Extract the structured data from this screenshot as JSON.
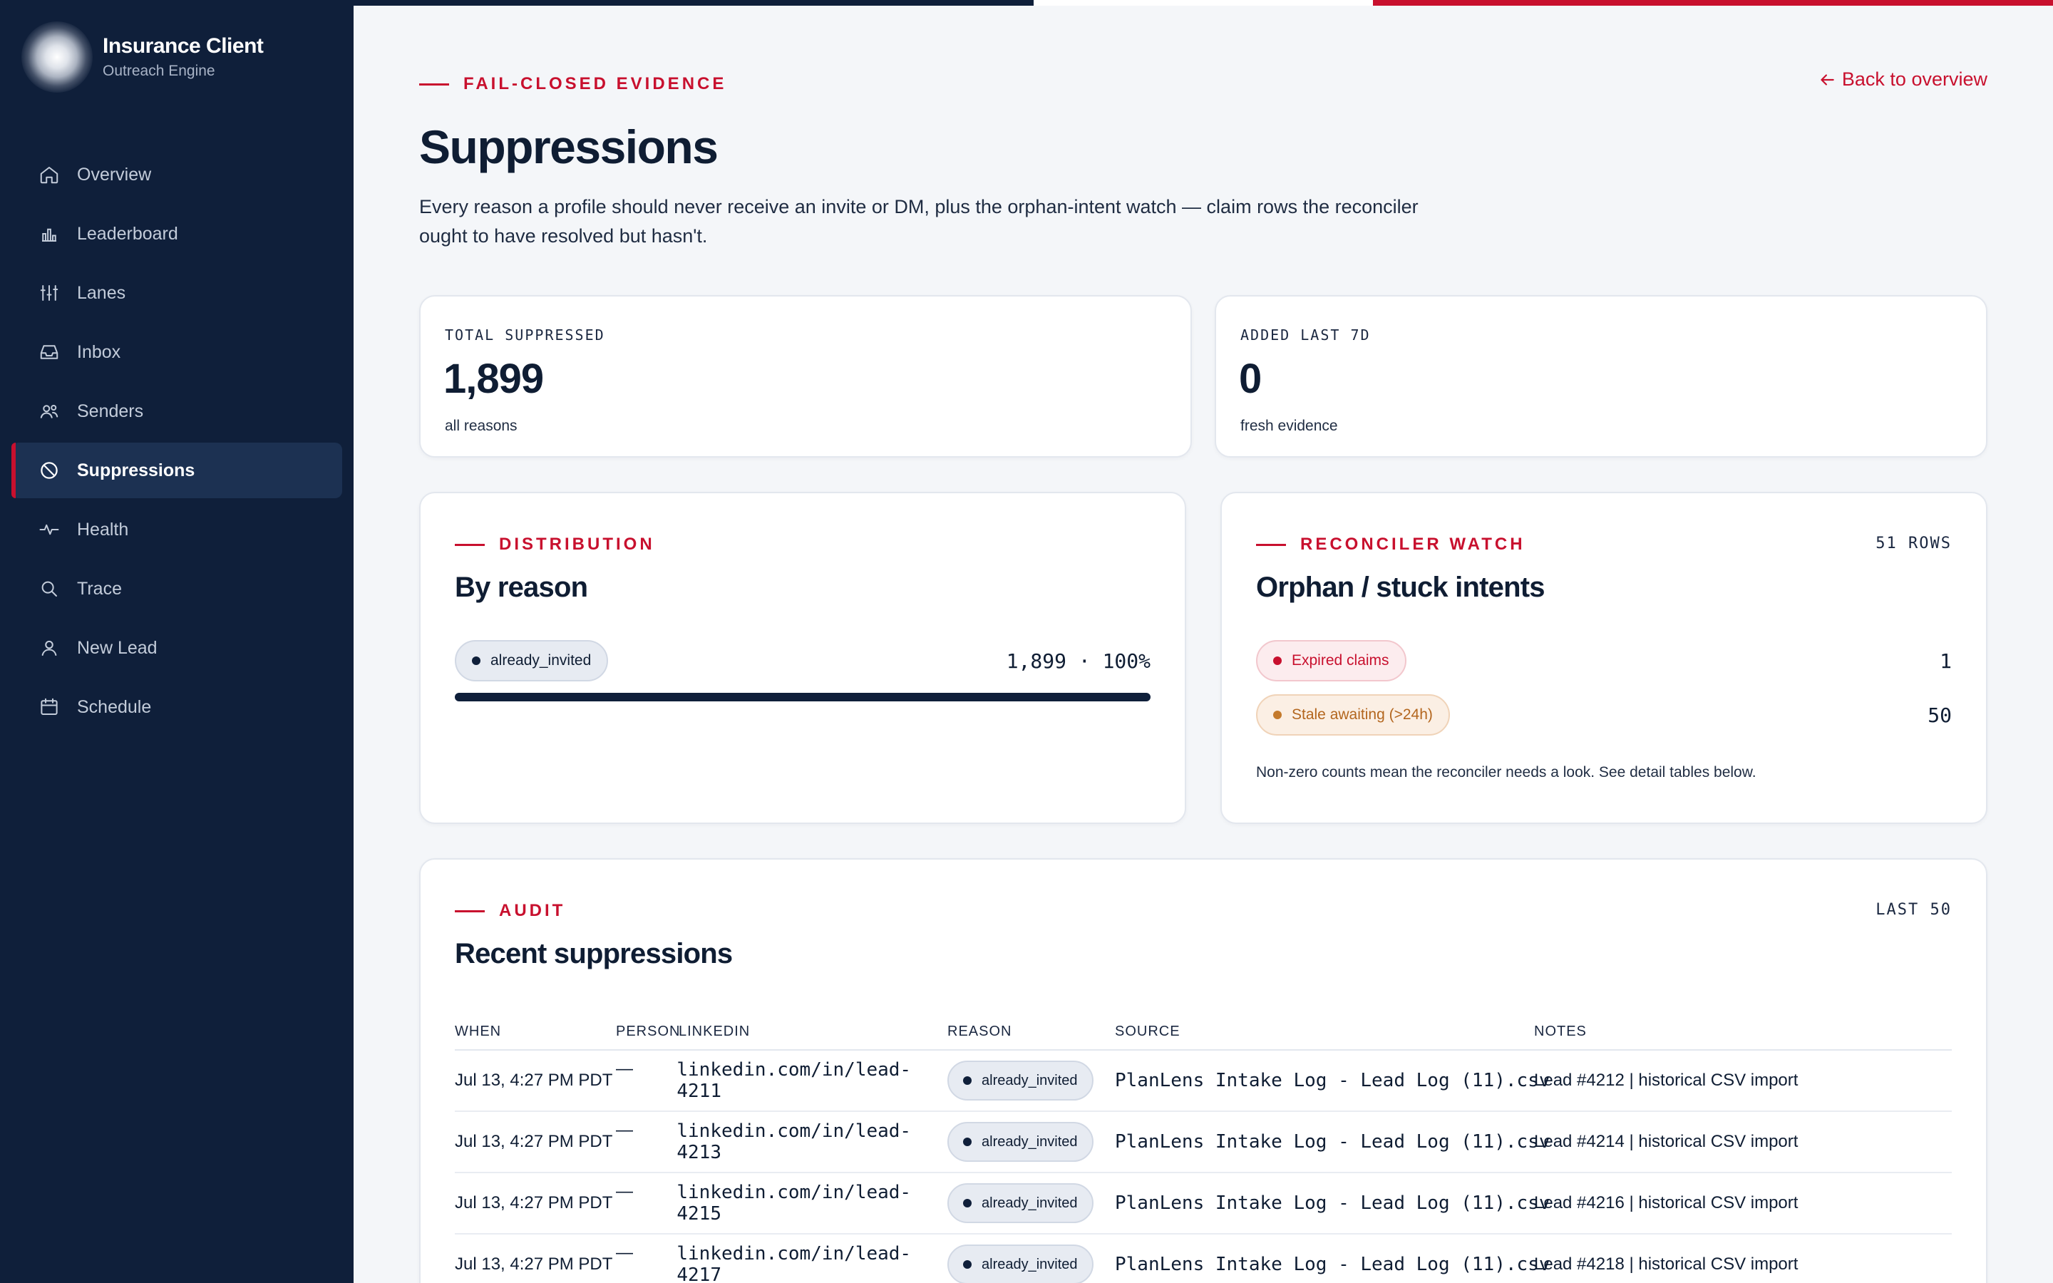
{
  "brand": {
    "title": "Insurance Client",
    "subtitle": "Outreach Engine"
  },
  "nav": [
    {
      "label": "Overview",
      "icon": "home-icon"
    },
    {
      "label": "Leaderboard",
      "icon": "bar-chart-icon"
    },
    {
      "label": "Lanes",
      "icon": "lanes-icon"
    },
    {
      "label": "Inbox",
      "icon": "inbox-icon"
    },
    {
      "label": "Senders",
      "icon": "users-icon"
    },
    {
      "label": "Suppressions",
      "icon": "ban-icon",
      "active": true
    },
    {
      "label": "Health",
      "icon": "pulse-icon"
    },
    {
      "label": "Trace",
      "icon": "search-icon"
    },
    {
      "label": "New Lead",
      "icon": "user-icon"
    },
    {
      "label": "Schedule",
      "icon": "calendar-icon"
    }
  ],
  "header": {
    "eyebrow": "FAIL-CLOSED EVIDENCE",
    "back_label": "Back to overview",
    "title": "Suppressions",
    "description": "Every reason a profile should never receive an invite or DM, plus the orphan-intent watch — claim rows the reconciler ought to have resolved but hasn't."
  },
  "stats": [
    {
      "label": "TOTAL SUPPRESSED",
      "value": "1,899",
      "sub": "all reasons"
    },
    {
      "label": "ADDED LAST 7D",
      "value": "0",
      "sub": "fresh evidence"
    }
  ],
  "distribution": {
    "eyebrow": "DISTRIBUTION",
    "title": "By reason",
    "rows": [
      {
        "reason": "already_invited",
        "value": "1,899 · 100%",
        "fraction": 1.0
      }
    ]
  },
  "reconciler": {
    "eyebrow": "RECONCILER WATCH",
    "title": "Orphan / stuck intents",
    "corner": "51 ROWS",
    "rows": [
      {
        "label": "Expired claims",
        "count": "1"
      },
      {
        "label": "Stale awaiting (>24h)",
        "count": "50"
      }
    ],
    "note": "Non-zero counts mean the reconciler needs a look. See detail tables below."
  },
  "audit": {
    "eyebrow": "AUDIT",
    "title": "Recent suppressions",
    "corner": "LAST 50",
    "columns": {
      "when": "WHEN",
      "person": "PERSON",
      "linkedin": "LINKEDIN",
      "reason": "REASON",
      "source": "SOURCE",
      "notes": "NOTES"
    },
    "rows": [
      {
        "when": "Jul 13, 4:27 PM PDT",
        "person": "—",
        "linkedin": "linkedin.com/in/lead-4211",
        "reason": "already_invited",
        "source": "PlanLens Intake Log - Lead Log (11).csv",
        "notes": "Lead #4212 | historical CSV import"
      },
      {
        "when": "Jul 13, 4:27 PM PDT",
        "person": "—",
        "linkedin": "linkedin.com/in/lead-4213",
        "reason": "already_invited",
        "source": "PlanLens Intake Log - Lead Log (11).csv",
        "notes": "Lead #4214 | historical CSV import"
      },
      {
        "when": "Jul 13, 4:27 PM PDT",
        "person": "—",
        "linkedin": "linkedin.com/in/lead-4215",
        "reason": "already_invited",
        "source": "PlanLens Intake Log - Lead Log (11).csv",
        "notes": "Lead #4216 | historical CSV import"
      },
      {
        "when": "Jul 13, 4:27 PM PDT",
        "person": "—",
        "linkedin": "linkedin.com/in/lead-4217",
        "reason": "already_invited",
        "source": "PlanLens Intake Log - Lead Log (11).csv",
        "notes": "Lead #4218 | historical CSV import"
      }
    ]
  },
  "colors": {
    "navy": "#0f1f3a",
    "accent_red": "#c8102e",
    "amber": "#b3661e",
    "page_bg": "#f4f6f9"
  }
}
